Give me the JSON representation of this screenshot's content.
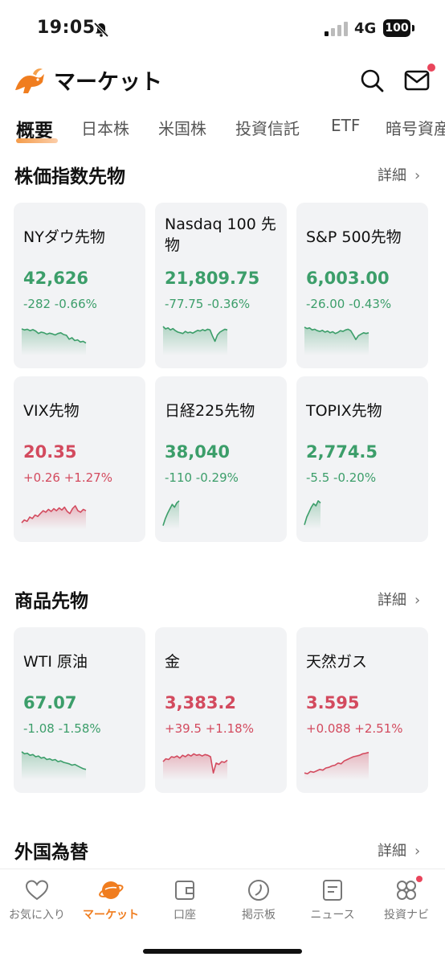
{
  "status": {
    "time": "19:05",
    "network": "4G",
    "battery": "100"
  },
  "header": {
    "title": "マーケット"
  },
  "tabs": [
    "概要",
    "日本株",
    "米国株",
    "投資信託",
    "ETF",
    "暗号資産"
  ],
  "sections": {
    "index": {
      "title": "株価指数先物",
      "detail": "詳細"
    },
    "commodity": {
      "title": "商品先物",
      "detail": "詳細"
    },
    "fx": {
      "title": "外国為替",
      "detail": "詳細"
    }
  },
  "cards": [
    {
      "name": "NYダウ先物",
      "price": "42,626",
      "change": "-282 -0.66%",
      "direction": "down",
      "spark": [
        0.75,
        0.72,
        0.74,
        0.7,
        0.73,
        0.69,
        0.62,
        0.66,
        0.64,
        0.6,
        0.63,
        0.61,
        0.58,
        0.62,
        0.64,
        0.59,
        0.57,
        0.46,
        0.5,
        0.42,
        0.44,
        0.38,
        0.4,
        0.35
      ]
    },
    {
      "name": "Nasdaq 100 先物",
      "price": "21,809.75",
      "change": "-77.75 -0.36%",
      "direction": "down",
      "spark": [
        0.82,
        0.75,
        0.78,
        0.72,
        0.76,
        0.7,
        0.66,
        0.64,
        0.62,
        0.68,
        0.64,
        0.66,
        0.63,
        0.67,
        0.71,
        0.69,
        0.73,
        0.7,
        0.74,
        0.72,
        0.55,
        0.4,
        0.58,
        0.66,
        0.7,
        0.74,
        0.72
      ]
    },
    {
      "name": "S&P 500先物",
      "price": "6,003.00",
      "change": "-26.00 -0.43%",
      "direction": "down",
      "spark": [
        0.8,
        0.76,
        0.78,
        0.72,
        0.74,
        0.7,
        0.68,
        0.71,
        0.66,
        0.69,
        0.64,
        0.67,
        0.62,
        0.65,
        0.7,
        0.68,
        0.72,
        0.74,
        0.7,
        0.58,
        0.45,
        0.56,
        0.6,
        0.64,
        0.62,
        0.64
      ]
    },
    {
      "name": "VIX先物",
      "price": "20.35",
      "change": "+0.26 +1.27%",
      "direction": "up",
      "spark": [
        0.18,
        0.26,
        0.22,
        0.34,
        0.3,
        0.4,
        0.36,
        0.44,
        0.52,
        0.48,
        0.56,
        0.5,
        0.58,
        0.52,
        0.6,
        0.54,
        0.62,
        0.5,
        0.44,
        0.58,
        0.66,
        0.52,
        0.48,
        0.56,
        0.52
      ]
    },
    {
      "name": "日経225先物",
      "price": "38,040",
      "change": "-110 -0.29%",
      "direction": "down",
      "spark": [
        0.1,
        0.3,
        0.45,
        0.58,
        0.7,
        0.62,
        0.74,
        0.8
      ]
    },
    {
      "name": "TOPIX先物",
      "price": "2,774.5",
      "change": "-5.5 -0.20%",
      "direction": "down",
      "spark": [
        0.12,
        0.34,
        0.48,
        0.62,
        0.72,
        0.66,
        0.8,
        0.74
      ]
    }
  ],
  "commodities": [
    {
      "name": "WTI 原油",
      "price": "67.07",
      "change": "-1.08 -1.58%",
      "direction": "down",
      "spark": [
        0.8,
        0.74,
        0.76,
        0.7,
        0.72,
        0.66,
        0.68,
        0.62,
        0.64,
        0.58,
        0.6,
        0.56,
        0.58,
        0.52,
        0.54,
        0.5,
        0.48,
        0.46,
        0.42,
        0.44,
        0.4,
        0.36,
        0.32,
        0.3
      ]
    },
    {
      "name": "金",
      "price": "3,383.2",
      "change": "+39.5 +1.18%",
      "direction": "up",
      "spark": [
        0.52,
        0.6,
        0.58,
        0.66,
        0.64,
        0.68,
        0.62,
        0.7,
        0.66,
        0.72,
        0.68,
        0.74,
        0.7,
        0.72,
        0.68,
        0.72,
        0.7,
        0.66,
        0.2,
        0.48,
        0.44,
        0.52,
        0.5,
        0.56
      ]
    },
    {
      "name": "天然ガス",
      "price": "3.595",
      "change": "+0.088 +2.51%",
      "direction": "up",
      "spark": [
        0.2,
        0.18,
        0.24,
        0.22,
        0.26,
        0.3,
        0.28,
        0.34,
        0.36,
        0.4,
        0.42,
        0.48,
        0.46,
        0.54,
        0.58,
        0.62,
        0.66,
        0.68,
        0.7,
        0.74,
        0.76,
        0.78
      ]
    }
  ],
  "bottom_nav": [
    {
      "label": "お気に入り",
      "icon": "heart-icon"
    },
    {
      "label": "マーケット",
      "icon": "planet-icon",
      "active": true
    },
    {
      "label": "口座",
      "icon": "wallet-icon"
    },
    {
      "label": "掲示板",
      "icon": "discussion-icon"
    },
    {
      "label": "ニュース",
      "icon": "news-icon"
    },
    {
      "label": "投資ナビ",
      "icon": "navi-icon",
      "badge": true
    }
  ],
  "colors": {
    "up": "#d34a5e",
    "down": "#3c9e6a",
    "accent": "#f07d1f"
  }
}
